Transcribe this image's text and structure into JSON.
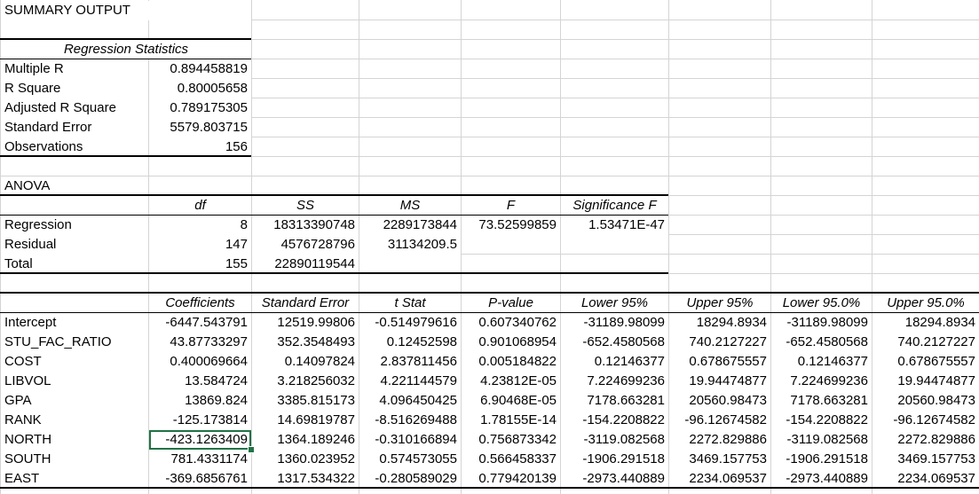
{
  "title": "SUMMARY OUTPUT",
  "regression_statistics": {
    "header": "Regression Statistics",
    "rows": [
      {
        "label": "Multiple R",
        "value": "0.894458819"
      },
      {
        "label": "R Square",
        "value": "0.80005658"
      },
      {
        "label": "Adjusted R Square",
        "value": "0.789175305"
      },
      {
        "label": "Standard Error",
        "value": "5579.803715"
      },
      {
        "label": "Observations",
        "value": "156"
      }
    ]
  },
  "anova": {
    "title": "ANOVA",
    "headers": [
      "df",
      "SS",
      "MS",
      "F",
      "Significance F"
    ],
    "rows": [
      {
        "label": "Regression",
        "cells": [
          "8",
          "18313390748",
          "2289173844",
          "73.52599859",
          "1.53471E-47"
        ]
      },
      {
        "label": "Residual",
        "cells": [
          "147",
          "4576728796",
          "31134209.5",
          "",
          ""
        ]
      },
      {
        "label": "Total",
        "cells": [
          "155",
          "22890119544",
          "",
          "",
          ""
        ]
      }
    ]
  },
  "coefficients": {
    "headers": [
      "Coefficients",
      "Standard Error",
      "t Stat",
      "P-value",
      "Lower 95%",
      "Upper 95%",
      "Lower 95.0%",
      "Upper 95.0%"
    ],
    "rows": [
      {
        "label": "Intercept",
        "cells": [
          "-6447.543791",
          "12519.99806",
          "-0.514979616",
          "0.607340762",
          "-31189.98099",
          "18294.8934",
          "-31189.98099",
          "18294.8934"
        ]
      },
      {
        "label": "STU_FAC_RATIO",
        "cells": [
          "43.87733297",
          "352.3548493",
          "0.12452598",
          "0.901068954",
          "-652.4580568",
          "740.2127227",
          "-652.4580568",
          "740.2127227"
        ]
      },
      {
        "label": "COST",
        "cells": [
          "0.400069664",
          "0.14097824",
          "2.837811456",
          "0.005184822",
          "0.12146377",
          "0.678675557",
          "0.12146377",
          "0.678675557"
        ]
      },
      {
        "label": "LIBVOL",
        "cells": [
          "13.584724",
          "3.218256032",
          "4.221144579",
          "4.23812E-05",
          "7.224699236",
          "19.94474877",
          "7.224699236",
          "19.94474877"
        ]
      },
      {
        "label": "GPA",
        "cells": [
          "13869.824",
          "3385.815173",
          "4.096450425",
          "6.90468E-05",
          "7178.663281",
          "20560.98473",
          "7178.663281",
          "20560.98473"
        ]
      },
      {
        "label": "RANK",
        "cells": [
          "-125.173814",
          "14.69819787",
          "-8.516269488",
          "1.78155E-14",
          "-154.2208822",
          "-96.12674582",
          "-154.2208822",
          "-96.12674582"
        ]
      },
      {
        "label": "NORTH",
        "cells": [
          "-423.1263409",
          "1364.189246",
          "-0.310166894",
          "0.756873342",
          "-3119.082568",
          "2272.829886",
          "-3119.082568",
          "2272.829886"
        ]
      },
      {
        "label": "SOUTH",
        "cells": [
          "781.4331174",
          "1360.023952",
          "0.574573055",
          "0.566458337",
          "-1906.291518",
          "3469.157753",
          "-1906.291518",
          "3469.157753"
        ]
      },
      {
        "label": "EAST",
        "cells": [
          "-369.6856761",
          "1317.534322",
          "-0.280589029",
          "0.779420139",
          "-2973.440889",
          "2234.069537",
          "-2973.440889",
          "2234.069537"
        ]
      }
    ]
  },
  "selected_cell": "NORTH coefficient",
  "colors": {
    "gridline": "#d4d4d4",
    "selection": "#217346"
  }
}
